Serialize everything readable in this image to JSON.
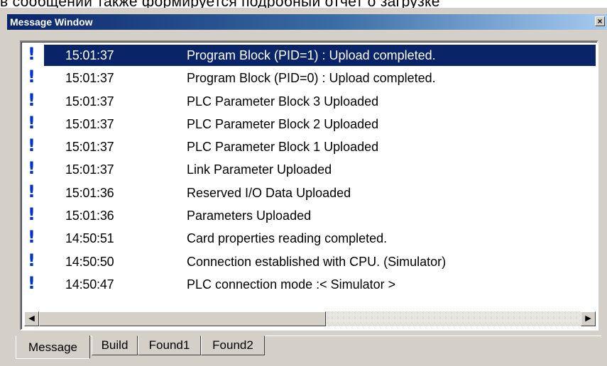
{
  "top_text": "в сообщении также формируется подробный отчет о загрузке",
  "window": {
    "title": "Message Window",
    "close_label": "×"
  },
  "messages": [
    {
      "icon": "!",
      "time": "15:01:37",
      "text": "Program Block (PID=1) : Upload completed.",
      "selected": true
    },
    {
      "icon": "!",
      "time": "15:01:37",
      "text": "Program Block (PID=0) : Upload completed."
    },
    {
      "icon": "!",
      "time": "15:01:37",
      "text": "PLC Parameter Block 3 Uploaded"
    },
    {
      "icon": "!",
      "time": "15:01:37",
      "text": "PLC Parameter Block 2 Uploaded"
    },
    {
      "icon": "!",
      "time": "15:01:37",
      "text": "PLC Parameter Block 1 Uploaded"
    },
    {
      "icon": "!",
      "time": "15:01:37",
      "text": "Link Parameter Uploaded"
    },
    {
      "icon": "!",
      "time": "15:01:36",
      "text": "Reserved I/O Data Uploaded"
    },
    {
      "icon": "!",
      "time": "15:01:36",
      "text": "Parameters Uploaded"
    },
    {
      "icon": "!",
      "time": "14:50:51",
      "text": "Card properties reading completed."
    },
    {
      "icon": "!",
      "time": "14:50:50",
      "text": "Connection established with CPU. (Simulator)"
    },
    {
      "icon": "!",
      "time": "14:50:47",
      "text": "PLC connection mode :< Simulator >"
    }
  ],
  "scrollbar": {
    "left_arrow": "◀",
    "right_arrow": "▶"
  },
  "tabs": [
    {
      "label": "Message",
      "active": true
    },
    {
      "label": "Build"
    },
    {
      "label": "Found1"
    },
    {
      "label": "Found2"
    }
  ],
  "colors": {
    "selection": "#0a246a",
    "icon": "#0033cc",
    "face": "#d4d0c8"
  }
}
